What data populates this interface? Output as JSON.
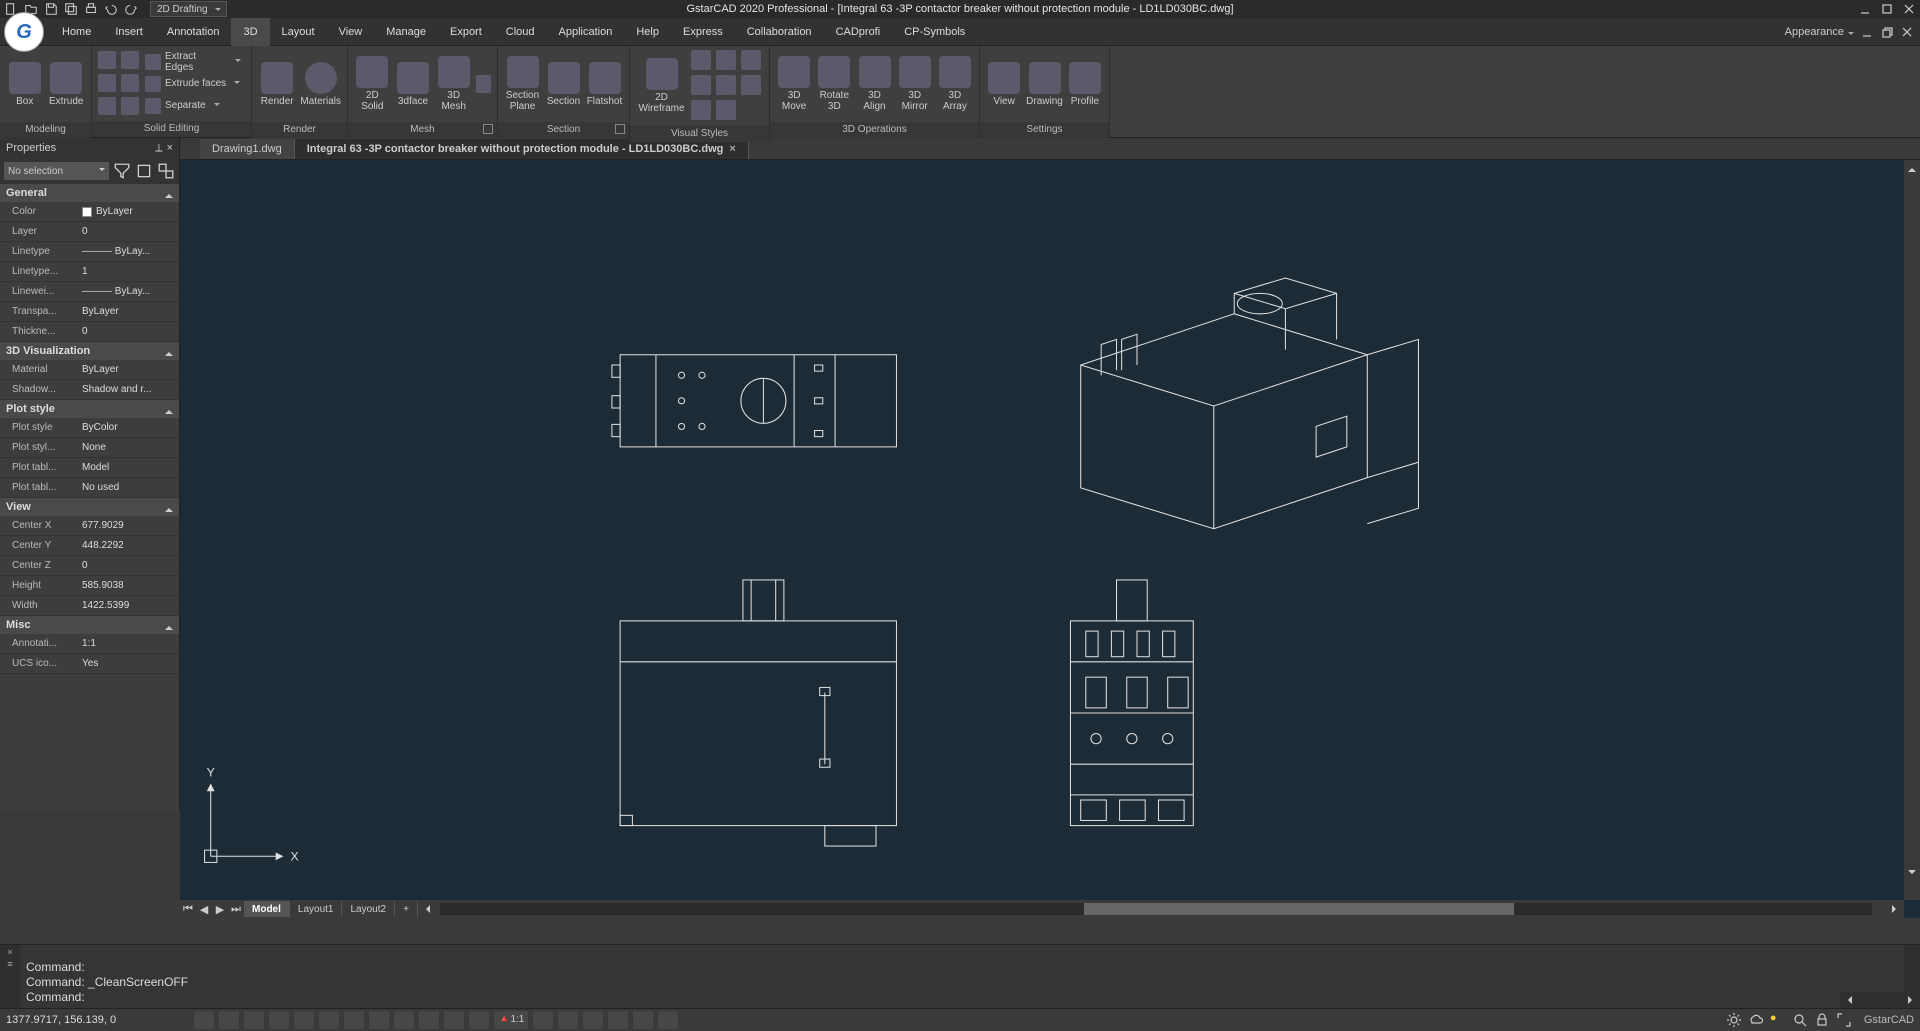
{
  "app": {
    "title": "GstarCAD 2020 Professional - [Integral 63 -3P contactor breaker without protection module - LD1LD030BC.dwg]",
    "workspace": "2D Drafting",
    "appearance_label": "Appearance"
  },
  "tabs": [
    "Home",
    "Insert",
    "Annotation",
    "3D",
    "Layout",
    "View",
    "Manage",
    "Export",
    "Cloud",
    "Application",
    "Help",
    "Express",
    "Collaboration",
    "CADprofi",
    "CP-Symbols"
  ],
  "active_tab": "3D",
  "ribbon": {
    "panels": [
      {
        "name": "Modeling",
        "big": [
          {
            "label": "Box"
          },
          {
            "label": "Extrude"
          }
        ]
      },
      {
        "name": "Solid Editing",
        "stack": [
          {
            "label": "Extract Edges"
          },
          {
            "label": "Extrude faces"
          },
          {
            "label": "Separate"
          }
        ]
      },
      {
        "name": "Render",
        "big": [
          {
            "label": "Render"
          },
          {
            "label": "Materials"
          }
        ]
      },
      {
        "name": "Mesh",
        "big": [
          {
            "label": "2D\nSolid"
          },
          {
            "label": "3dface"
          },
          {
            "label": "3D\nMesh"
          }
        ]
      },
      {
        "name": "Section",
        "big": [
          {
            "label": "Section\nPlane"
          },
          {
            "label": "Section"
          },
          {
            "label": "Flatshot"
          }
        ]
      },
      {
        "name": "Visual Styles",
        "big": [
          {
            "label": "2D\nWireframe"
          }
        ]
      },
      {
        "name": "3D Operations",
        "big": [
          {
            "label": "3D\nMove"
          },
          {
            "label": "Rotate\n3D"
          },
          {
            "label": "3D\nAlign"
          },
          {
            "label": "3D\nMirror"
          },
          {
            "label": "3D\nArray"
          }
        ]
      },
      {
        "name": "Settings",
        "big": [
          {
            "label": "View"
          },
          {
            "label": "Drawing"
          },
          {
            "label": "Profile"
          }
        ]
      }
    ]
  },
  "doctabs": [
    {
      "label": "Drawing1.dwg",
      "active": false
    },
    {
      "label": "Integral 63 -3P contactor breaker without protection module - LD1LD030BC.dwg",
      "active": true
    }
  ],
  "properties": {
    "title": "Properties",
    "selection": "No selection",
    "groups": [
      {
        "name": "General",
        "rows": [
          {
            "k": "Color",
            "v": "ByLayer",
            "swatch": true
          },
          {
            "k": "Layer",
            "v": "0"
          },
          {
            "k": "Linetype",
            "v": "——— ByLay..."
          },
          {
            "k": "Linetype...",
            "v": "1"
          },
          {
            "k": "Linewei...",
            "v": "——— ByLay..."
          },
          {
            "k": "Transpa...",
            "v": "ByLayer"
          },
          {
            "k": "Thickne...",
            "v": "0"
          }
        ]
      },
      {
        "name": "3D Visualization",
        "rows": [
          {
            "k": "Material",
            "v": "ByLayer"
          },
          {
            "k": "Shadow...",
            "v": "Shadow and r..."
          }
        ]
      },
      {
        "name": "Plot style",
        "rows": [
          {
            "k": "Plot style",
            "v": "ByColor"
          },
          {
            "k": "Plot styl...",
            "v": "None"
          },
          {
            "k": "Plot tabl...",
            "v": "Model"
          },
          {
            "k": "Plot tabl...",
            "v": "No used"
          }
        ]
      },
      {
        "name": "View",
        "rows": [
          {
            "k": "Center X",
            "v": "677.9029"
          },
          {
            "k": "Center Y",
            "v": "448.2292"
          },
          {
            "k": "Center Z",
            "v": "0"
          },
          {
            "k": "Height",
            "v": "585.9038"
          },
          {
            "k": "Width",
            "v": "1422.5399"
          }
        ]
      },
      {
        "name": "Misc",
        "rows": [
          {
            "k": "Annotati...",
            "v": "1:1"
          },
          {
            "k": "UCS ico...",
            "v": "Yes"
          }
        ]
      }
    ]
  },
  "model_tabs": [
    "Model",
    "Layout1",
    "Layout2"
  ],
  "active_model_tab": "Model",
  "command": {
    "lines": [
      "Command:",
      "Command: _CleanScreenOFF",
      "Command:"
    ]
  },
  "status": {
    "coords": "1377.9717, 156.139, 0",
    "scale": "1:1",
    "brand": "GstarCAD"
  }
}
